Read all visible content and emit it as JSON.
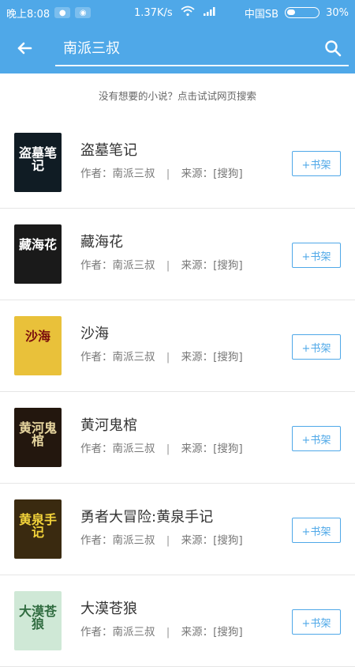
{
  "status_bar": {
    "time": "晚上8:08",
    "network_speed": "1.37K/s",
    "carrier": "中国SB",
    "battery": "30%"
  },
  "toolbar": {
    "search_value": "南派三叔",
    "back_icon": "arrow-left-icon",
    "search_icon": "search-icon"
  },
  "hint": {
    "text": "没有想要的小说？点击试试网页搜索"
  },
  "results": {
    "add_label": "+书架",
    "author_label": "作者：",
    "source_label": "来源：",
    "items": [
      {
        "title": "盗墓笔记",
        "author": "南派三叔",
        "source": "[搜狗]",
        "cover_text": "盗墓笔记",
        "cover_color": "#101c24",
        "cover_text_color": "#ffffff"
      },
      {
        "title": "藏海花",
        "author": "南派三叔",
        "source": "[搜狗]",
        "cover_text": "藏海花",
        "cover_color": "#1a1a1a",
        "cover_text_color": "#ffffff"
      },
      {
        "title": "沙海",
        "author": "南派三叔",
        "source": "[搜狗]",
        "cover_text": "沙海",
        "cover_color": "#e9c13a",
        "cover_text_color": "#7a0d0d"
      },
      {
        "title": "黄河鬼棺",
        "author": "南派三叔",
        "source": "[搜狗]",
        "cover_text": "黄河鬼棺",
        "cover_color": "#23170e",
        "cover_text_color": "#e8d7a0"
      },
      {
        "title": "勇者大冒险:黄泉手记",
        "author": "南派三叔",
        "source": "[搜狗]",
        "cover_text": "黄泉手记",
        "cover_color": "#3a2a10",
        "cover_text_color": "#f2d23a"
      },
      {
        "title": "大漠苍狼",
        "author": "南派三叔",
        "source": "[搜狗]",
        "cover_text": "大漠苍狼",
        "cover_color": "#cfe8d6",
        "cover_text_color": "#2f6b3f"
      }
    ]
  },
  "colors": {
    "accent": "#4fa8e8"
  }
}
